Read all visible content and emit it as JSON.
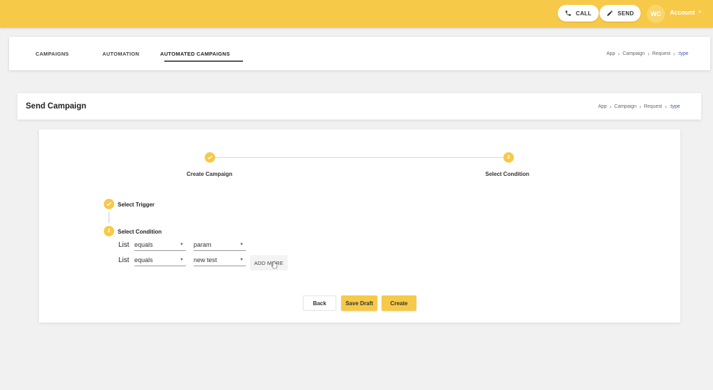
{
  "topbar": {
    "call_label": "CALL",
    "send_label": "SEND",
    "avatar_initials": "WC",
    "account_label": "Account",
    "accent_color": "#f7c948"
  },
  "tabs": [
    {
      "label": "CAMPAIGNS"
    },
    {
      "label": "AUTOMATION"
    },
    {
      "label": "AUTOMATED CAMPAIGNS",
      "active": true
    }
  ],
  "breadcrumb_top": [
    "App",
    "Campaign",
    "Request",
    ":type"
  ],
  "page": {
    "title": "Send Campaign",
    "breadcrumb": [
      "App",
      "Campaign",
      "Request",
      ":type"
    ]
  },
  "stepper": {
    "steps": [
      {
        "label": "Create Campaign",
        "state": "done",
        "icon": "check-icon"
      },
      {
        "label": "Select Condition",
        "state": "active",
        "number": "2"
      }
    ]
  },
  "vertical_steps": [
    {
      "label": "Select Trigger",
      "state": "done",
      "icon": "check-icon"
    },
    {
      "label": "Select Condition",
      "state": "active",
      "number": "2"
    }
  ],
  "conditions": [
    {
      "field": "List",
      "operator": "equals",
      "value": "param"
    },
    {
      "field": "List",
      "operator": "equals",
      "value": "new test"
    }
  ],
  "add_more_label": "ADD MORE",
  "actions": {
    "back": "Back",
    "save_draft": "Save Draft",
    "create": "Create"
  }
}
